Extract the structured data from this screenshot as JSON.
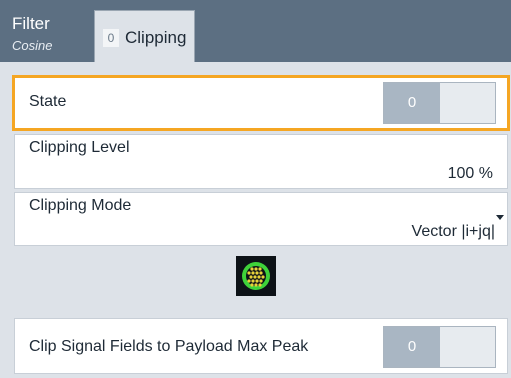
{
  "tabs": {
    "filter": {
      "label": "Filter",
      "sublabel": "Cosine"
    },
    "clipping": {
      "indicator": "0",
      "label": "Clipping"
    }
  },
  "state": {
    "label": "State",
    "value": "0"
  },
  "clipping_level": {
    "label": "Clipping Level",
    "value": "100  %"
  },
  "clipping_mode": {
    "label": "Clipping Mode",
    "value": "Vector |i+jq|"
  },
  "diagram_icon": "clipping-diagram-icon",
  "clip_signal_fields": {
    "label": "Clip Signal Fields to Payload Max Peak",
    "value": "0"
  },
  "colors": {
    "tabbar": "#5c6f82",
    "panel": "#dde2e8",
    "focus": "#f5a623",
    "toggle_knob": "#a9b6c3",
    "icon_green": "#3fd23a",
    "icon_dots": "#e8d23a"
  }
}
